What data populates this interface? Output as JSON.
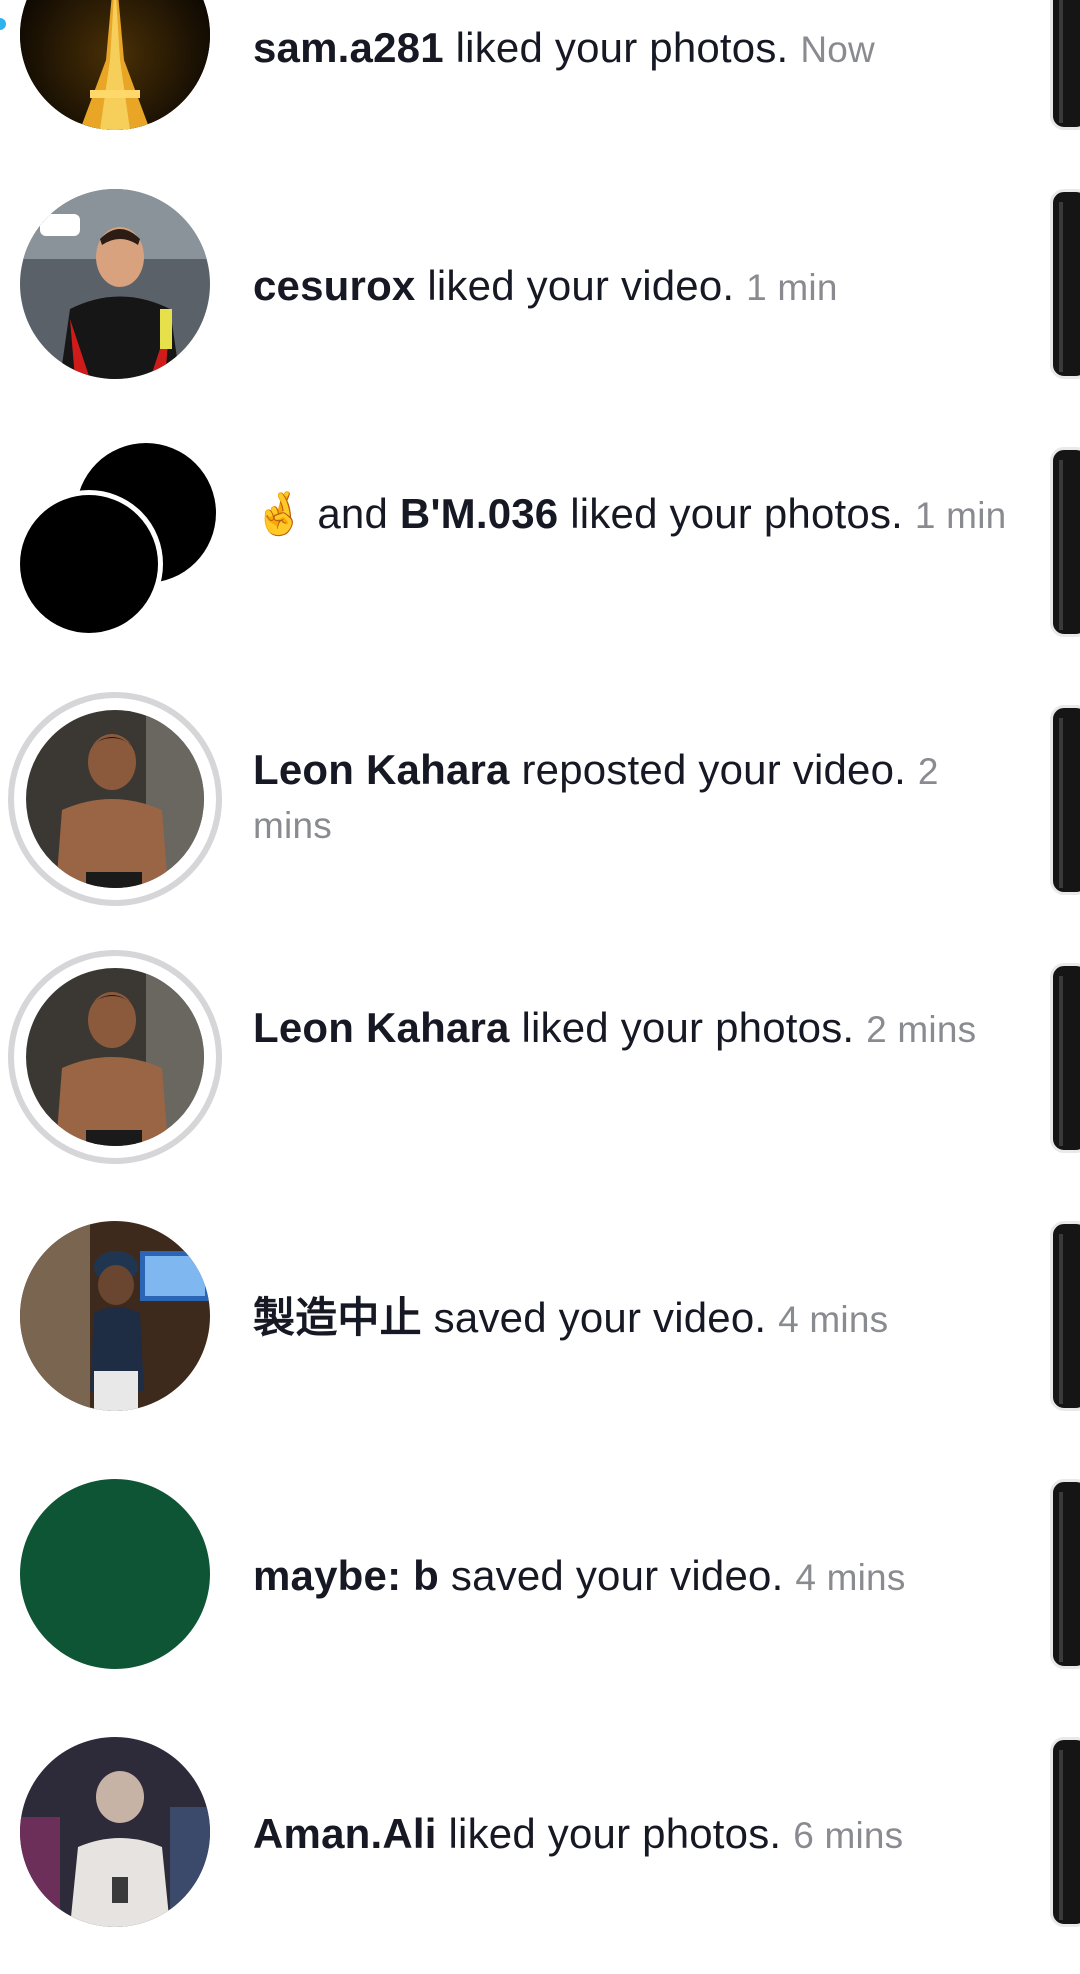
{
  "notifications": [
    {
      "user": "sam.a281",
      "action": " liked your photos.",
      "time": "Now",
      "avatar": "eiffel-tower-photo"
    },
    {
      "user": "cesurox",
      "action": " liked your video.",
      "time": "1 min",
      "avatar": "football-player-photo"
    },
    {
      "prefix_emoji": "🤞",
      "user": "B'M.036",
      "action_pre": " and ",
      "action": " liked your photos.",
      "time": "1 min",
      "avatar": "double-black-avatar"
    },
    {
      "user": "Leon Kahara",
      "action": " reposted your video.",
      "time": "2 mins",
      "avatar": "shirtless-man-photo"
    },
    {
      "user": "Leon Kahara",
      "action": " liked your photos.",
      "time": "2 mins",
      "avatar": "shirtless-man-photo"
    },
    {
      "user": "製造中止",
      "action": " saved your video.",
      "time": "4 mins",
      "avatar": "toddler-photo"
    },
    {
      "user": "maybe: b",
      "action": " saved your video.",
      "time": "4 mins",
      "avatar": "green-circle-avatar"
    },
    {
      "user": "Aman.Ali",
      "action": " liked your photos.",
      "time": "6 mins",
      "avatar": "person-blurred-photo"
    }
  ],
  "colors": {
    "accent_dot": "#2fb2f0",
    "green_avatar": "#0e5535",
    "time_gray": "#8a8b91"
  }
}
